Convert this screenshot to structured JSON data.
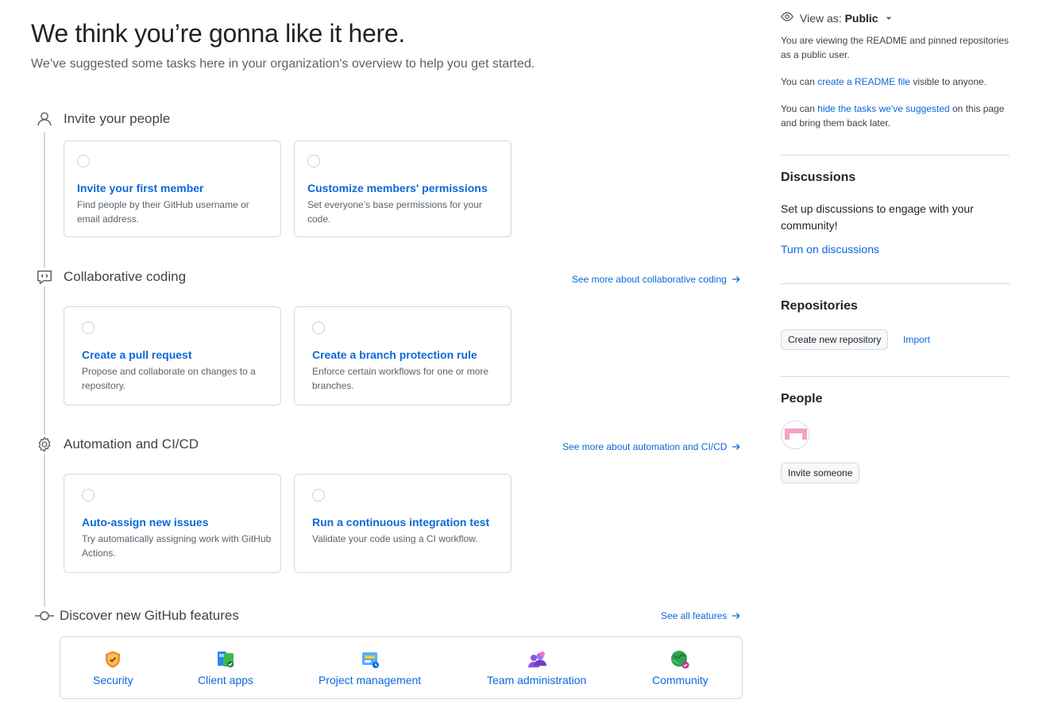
{
  "hero": {
    "title": "We think you’re gonna like it here.",
    "subtitle": "We’ve suggested some tasks here in your organization's overview to help you get started."
  },
  "sections": [
    {
      "title": "Invite your people",
      "icon": "person-icon",
      "see_more": "",
      "cards": [
        {
          "title": "Invite your first member",
          "desc": "Find people by their GitHub username or email address."
        },
        {
          "title": "Customize members' permissions",
          "desc": "Set everyone’s base permissions for your code."
        }
      ]
    },
    {
      "title": "Collaborative coding",
      "icon": "code-review-icon",
      "see_more": "See more about collaborative coding",
      "cards": [
        {
          "title": "Create a pull request",
          "desc": "Propose and collaborate on changes to a repository."
        },
        {
          "title": "Create a branch protection rule",
          "desc": "Enforce certain workflows for one or more branches."
        }
      ]
    },
    {
      "title": "Automation and CI/CD",
      "icon": "gear-icon",
      "see_more": "See more about automation and CI/CD",
      "cards": [
        {
          "title": "Auto-assign new issues",
          "desc": "Try automatically assigning work with GitHub Actions."
        },
        {
          "title": "Run a continuous integration test",
          "desc": "Validate your code using a CI workflow."
        }
      ]
    }
  ],
  "discover": {
    "title": "Discover new GitHub features",
    "see_all": "See all features",
    "features": [
      {
        "label": "Security",
        "icon": "shield-icon"
      },
      {
        "label": "Client apps",
        "icon": "client-apps-icon"
      },
      {
        "label": "Project management",
        "icon": "project-board-icon"
      },
      {
        "label": "Team administration",
        "icon": "team-icon"
      },
      {
        "label": "Community",
        "icon": "globe-icon"
      }
    ]
  },
  "sidebar": {
    "view_as_prefix": "View as:",
    "view_as_value": "Public",
    "viewing_text": "You are viewing the README and pinned repositories as a public user.",
    "readme_prefix": "You can ",
    "readme_link": "create a README file",
    "readme_suffix": " visible to anyone.",
    "hide_prefix": "You can ",
    "hide_link": "hide the tasks we've suggested",
    "hide_suffix": " on this page and bring them back later.",
    "discussions": {
      "heading": "Discussions",
      "body": "Set up discussions to engage with your community!",
      "link": "Turn on discussions"
    },
    "repositories": {
      "heading": "Repositories",
      "create_button": "Create new repository",
      "import_link": "Import"
    },
    "people": {
      "heading": "People",
      "invite_button": "Invite someone"
    }
  },
  "colors": {
    "link": "#0969da",
    "border": "#d1d9e0",
    "muted": "#59636e"
  }
}
